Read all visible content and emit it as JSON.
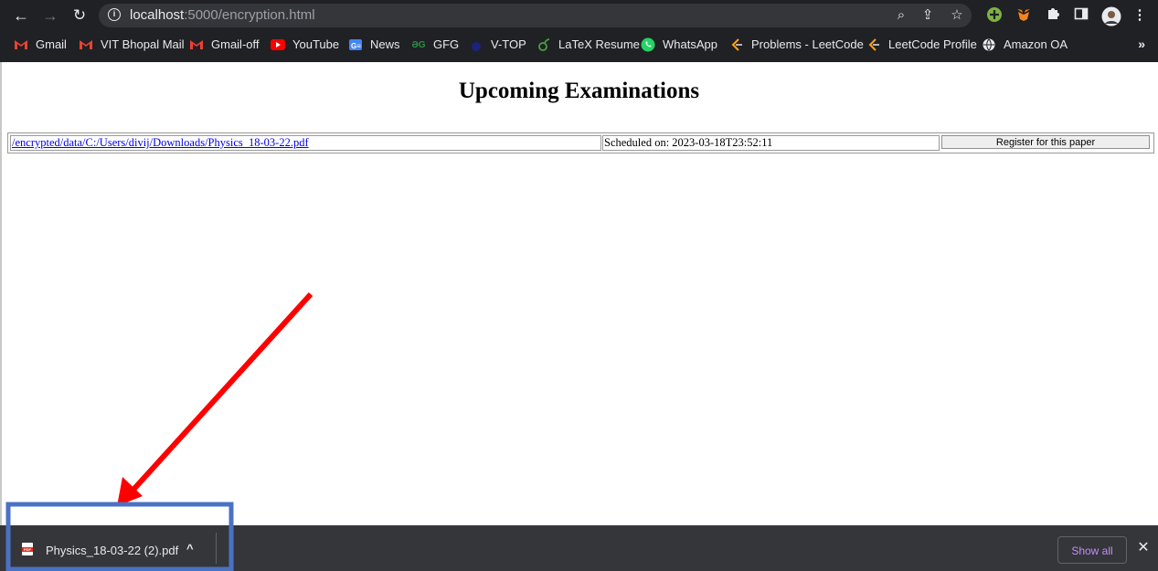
{
  "browser": {
    "url_host": "localhost",
    "url_path": ":5000/encryption.html",
    "bookmarks": [
      {
        "label": "Gmail",
        "icon": "gmail-icon",
        "icon_char": "M",
        "color": "#ea4335"
      },
      {
        "label": "VIT Bhopal Mail",
        "icon": "gmail-icon",
        "icon_char": "M",
        "color": "#ea4335"
      },
      {
        "label": "Gmail-off",
        "icon": "gmail-icon",
        "icon_char": "M",
        "color": "#ea4335"
      },
      {
        "label": "YouTube",
        "icon": "youtube-icon",
        "icon_char": "▶",
        "color": "#ff0000"
      },
      {
        "label": "News",
        "icon": "google-news-icon",
        "icon_char": "G",
        "color": "#4285f4"
      },
      {
        "label": "GFG",
        "icon": "gfg-icon",
        "icon_char": "ƏG",
        "color": "#2f8d46"
      },
      {
        "label": "V-TOP",
        "icon": "vtop-icon",
        "icon_char": "●",
        "color": "#1a237e"
      },
      {
        "label": "LaTeX Resume",
        "icon": "overleaf-icon",
        "icon_char": "ô",
        "color": "#47a141"
      },
      {
        "label": "WhatsApp",
        "icon": "whatsapp-icon",
        "icon_char": "✆",
        "color": "#25d366"
      },
      {
        "label": "Problems - LeetCode",
        "icon": "leetcode-icon",
        "icon_char": "⟨",
        "color": "#ffa116"
      },
      {
        "label": "LeetCode Profile",
        "icon": "leetcode-icon",
        "icon_char": "⟨",
        "color": "#ffa116"
      },
      {
        "label": "Amazon OA",
        "icon": "globe-icon",
        "icon_char": "◍",
        "color": "#e8eaed"
      }
    ],
    "more_label": "»"
  },
  "page": {
    "title": "Upcoming Examinations",
    "exams": [
      {
        "file_link": "/encrypted/data/C:/Users/divij/Downloads/Physics_18-03-22.pdf",
        "schedule": "Scheduled on: 2023-03-18T23:52:11",
        "button_label": "Register for this paper"
      }
    ]
  },
  "downloads": {
    "file_name": "Physics_18-03-22 (2).pdf",
    "show_all_label": "Show all"
  },
  "annotation": {
    "arrow_color": "#ff0000",
    "box_color": "#4a72c4"
  }
}
